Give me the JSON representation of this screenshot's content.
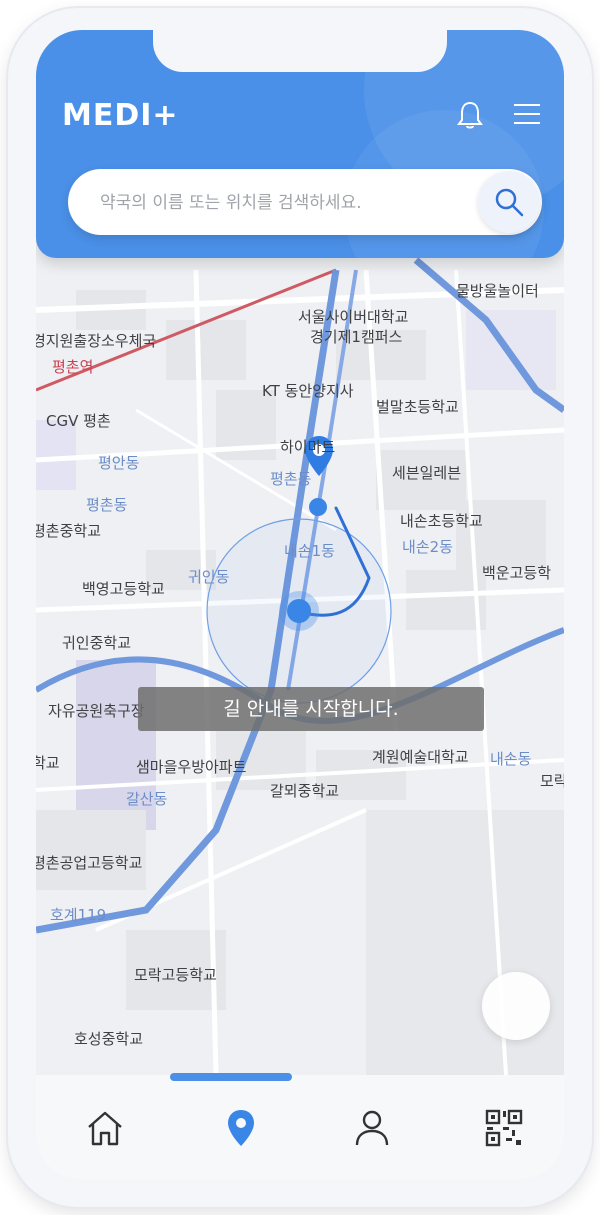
{
  "app": {
    "logo": "MEDI+",
    "colors": {
      "accent": "#4a90e8",
      "route": "#2f6fd6",
      "toast_bg": "#6e6e6e"
    }
  },
  "header": {
    "bell_icon": "bell-icon",
    "menu_icon": "hamburger-menu-icon"
  },
  "search": {
    "placeholder": "약국의 이름 또는 위치를 검색하세요.",
    "button_icon": "search-icon"
  },
  "map": {
    "labels": {
      "l1": "물방울놀이터",
      "l2": "서울사이버대학교",
      "l3": "경기제1캠퍼스",
      "l4": "경지원출장소우체국",
      "l5": "평촌역",
      "l6": "KT 동안양지사",
      "l7": "벌말초등학교",
      "l8": "CGV 평촌",
      "l9": "하이마트",
      "l10": "평안동",
      "l11": "평촌동",
      "l12": "세븐일레븐",
      "l13": "평촌동",
      "l14": "내손초등학교",
      "l15": "평촌중학교",
      "l16": "내손1동",
      "l17": "내손2동",
      "l18": "백운고등학",
      "l19": "백영고등학교",
      "l20": "귀인동",
      "l21": "귀인중학교",
      "l22": "자유공원축구장",
      "l23": "학교",
      "l24": "샘마을우방아파트",
      "l25": "계원예술대학교",
      "l26": "내손동",
      "l27": "모락",
      "l28": "갈뫼중학교",
      "l29": "갈산동",
      "l30": "평촌공업고등학교",
      "l31": "호계119",
      "l32": "모락고등학교",
      "l33": "호성중학교"
    },
    "toast": "길 안내를 시작합니다.",
    "destination_icon": "location-pin-icon",
    "current_location_icon": "current-location-dot-icon",
    "locate_button_icon": "locate-button"
  },
  "bottom_nav": {
    "items": [
      {
        "icon": "home-icon",
        "active": false
      },
      {
        "icon": "location-pin-icon",
        "active": true
      },
      {
        "icon": "user-icon",
        "active": false
      },
      {
        "icon": "qr-code-icon",
        "active": false
      }
    ]
  }
}
